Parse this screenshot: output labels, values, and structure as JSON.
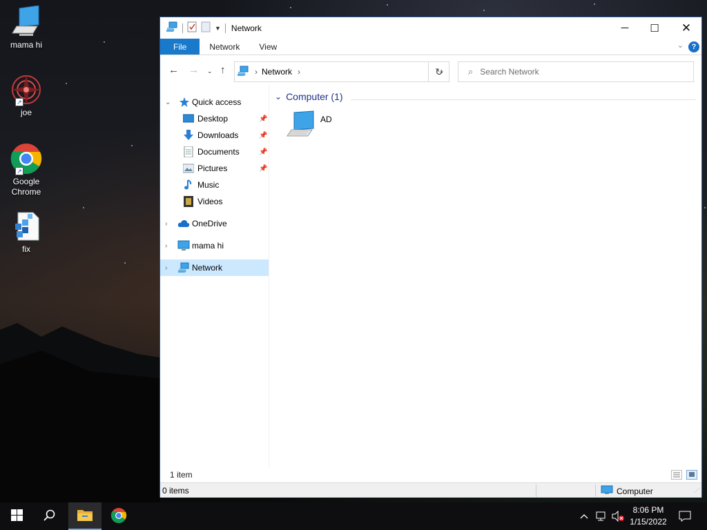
{
  "desktop": {
    "icons": [
      {
        "label": "mama hi",
        "icon": "computer-icon"
      },
      {
        "label": "joe",
        "icon": "mandala-image-icon"
      },
      {
        "label": "Google Chrome",
        "icon": "chrome-icon"
      },
      {
        "label": "fix",
        "icon": "registry-file-icon"
      }
    ]
  },
  "window": {
    "title": "Network",
    "ribbon_tabs": [
      "File",
      "Network",
      "View"
    ],
    "address": {
      "crumbs": [
        "Network"
      ]
    },
    "search": {
      "placeholder": "Search Network"
    },
    "nav_pane": {
      "quick_access": "Quick access",
      "items": [
        "Desktop",
        "Downloads",
        "Documents",
        "Pictures",
        "Music",
        "Videos"
      ],
      "onedrive": "OneDrive",
      "this_pc": "mama hi",
      "network": "Network"
    },
    "content": {
      "group_header": "Computer (1)",
      "items": [
        {
          "label": "AD",
          "icon": "computer-icon"
        }
      ]
    },
    "status": {
      "item_count": "1 item",
      "selection": "0 items",
      "zone": "Computer"
    }
  },
  "taskbar": {
    "clock_time": "8:06 PM",
    "clock_date": "1/15/2022"
  },
  "colors": {
    "accent": "#1979ca",
    "selection": "#cce8ff",
    "group_header": "#1e3287"
  }
}
